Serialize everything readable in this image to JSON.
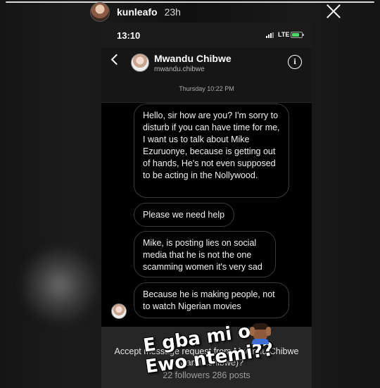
{
  "story": {
    "username": "kunleafo",
    "time": "23h",
    "close_icon": "close-icon"
  },
  "status_bar": {
    "time": "13:10",
    "network": "LTE",
    "battery_color": "#4cd964"
  },
  "dm_header": {
    "name": "Mwandu Chibwe",
    "username": "mwandu.chibwe",
    "back_icon": "chevron-left-icon",
    "info_icon": "info-icon",
    "info_glyph": "i"
  },
  "conversation": {
    "timestamp": "Thursday 10:22 PM",
    "messages": [
      "Hello, sir how are you? I'm sorry to disturb if you can have time for me, I want us to talk about Mike Ezuruonye, because is getting out of hands,  He's not even supposed to be acting in the Nollywood.",
      "Please we need help",
      "Mike, is posting lies on social media that he is not the one scamming women it's very sad",
      "Because he is making people, not to watch Nigerian movies"
    ]
  },
  "request": {
    "text": "Accept message request from Mwandu Chibwe (mwandu.chibwe)?",
    "stats": "22 followers 286 posts"
  },
  "overlay": {
    "line1": "E gba mi o",
    "line2": "Ewo ntemi??",
    "emoji": "person-facepalming-emoji"
  }
}
